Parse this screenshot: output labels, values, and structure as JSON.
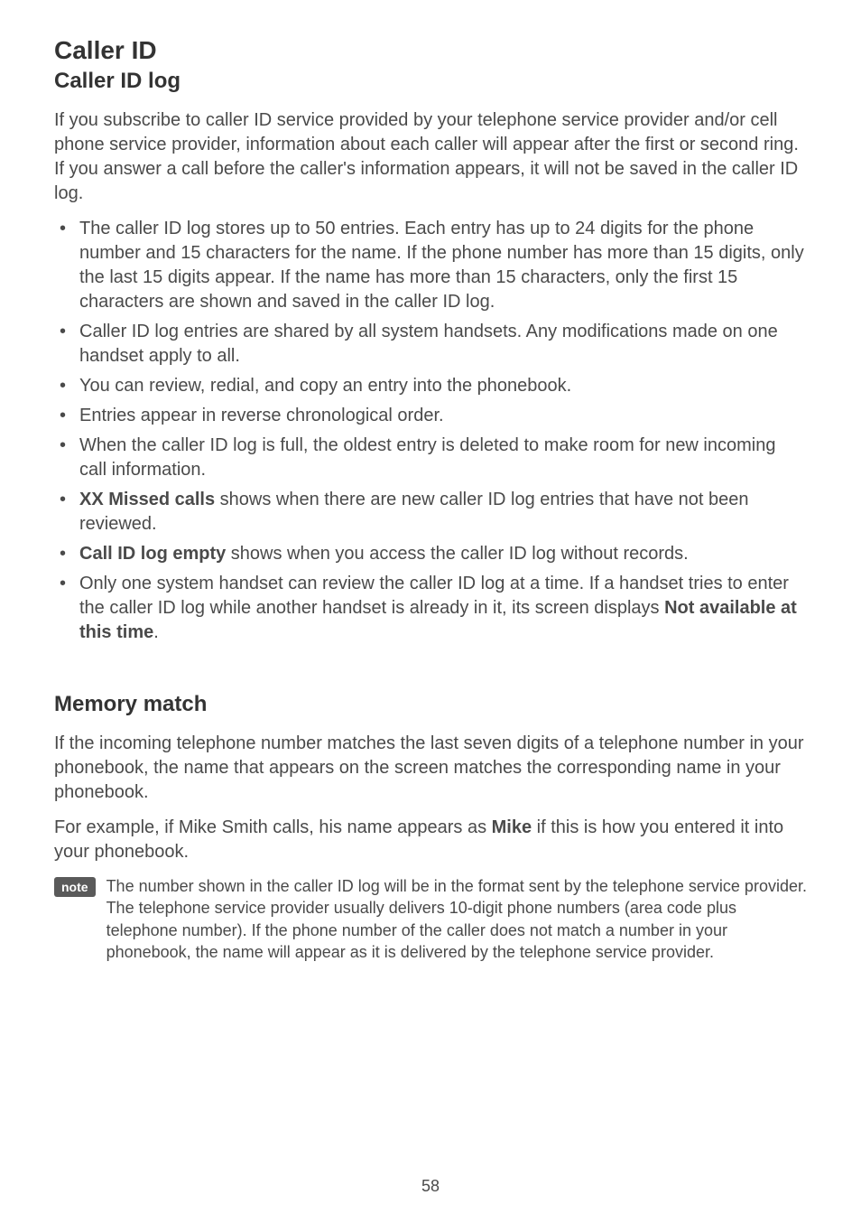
{
  "section_title": "Caller ID",
  "subsection1_title": "Caller ID log",
  "intro_paragraph": "If you subscribe to caller ID service provided by your telephone service provider and/or cell phone service provider, information about each caller will appear after the first or second ring. If you answer a call before the caller's information appears, it will not be saved in the caller ID log.",
  "bullets": {
    "b1": "The caller ID log stores up to 50 entries. Each entry has up to 24 digits for the phone number and 15 characters for the name. If the phone number has more than 15 digits, only the last 15 digits appear. If the name has more than 15 characters, only the first 15 characters are shown and saved in the caller ID log.",
    "b2": "Caller ID log entries are shared by all system handsets. Any modifications made on one handset apply to all.",
    "b3": "You can review, redial, and copy an entry into the phonebook.",
    "b4": "Entries appear in reverse chronological order.",
    "b5": "When the caller ID log is full, the oldest entry is deleted to make room for new incoming call information.",
    "b6_bold": "XX Missed calls",
    "b6_rest": " shows when there are new caller ID log entries that have not been reviewed.",
    "b7_bold": "Call ID log empty",
    "b7_rest": " shows when you access the caller ID log without records.",
    "b8_pre": "Only one system handset can review the caller ID log at a time. If a handset tries to enter the caller ID log while another handset is already in it, its screen displays ",
    "b8_bold": "Not available at this time",
    "b8_post": "."
  },
  "subsection2_title": "Memory match",
  "memory_p1": "If the incoming telephone number matches the last seven digits of a telephone number in your phonebook, the name that appears on the screen matches the corresponding name in your phonebook.",
  "memory_p2_pre": "For example, if Mike Smith calls, his name appears as ",
  "memory_p2_bold": "Mike",
  "memory_p2_post": " if this is how you entered it into your phonebook.",
  "note_label": "note",
  "note_text": "The number shown in the caller ID log will be in the format sent by the telephone service provider. The telephone service provider usually delivers 10-digit phone numbers (area code plus telephone number). If the phone number of the caller does not match a number in your phonebook, the name will appear as it is delivered by the telephone service provider.",
  "page_number": "58"
}
